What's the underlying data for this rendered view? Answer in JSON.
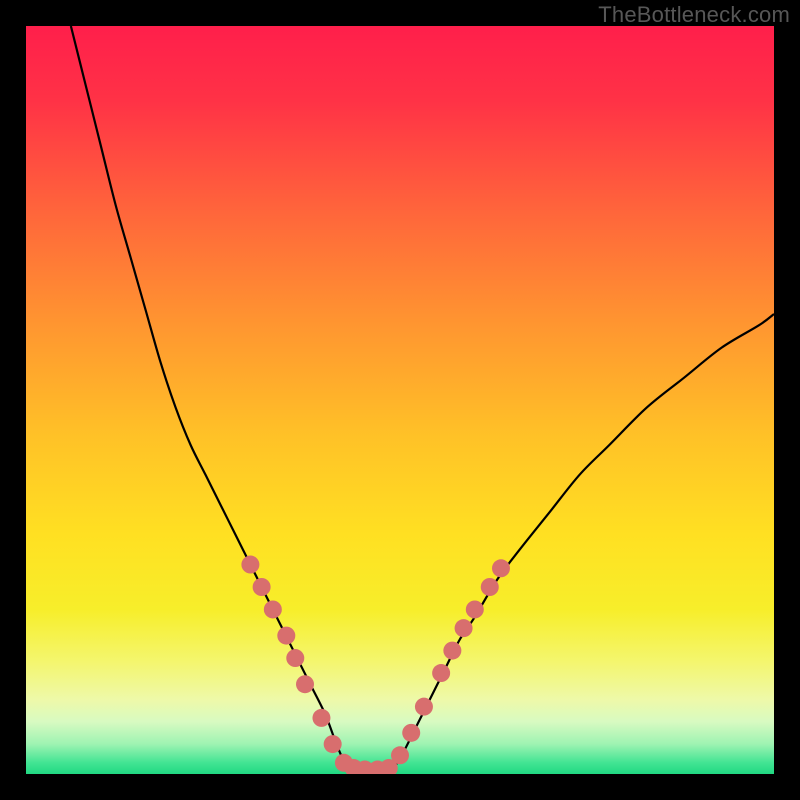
{
  "watermark": "TheBottleneck.com",
  "chart_data": {
    "type": "line",
    "title": "",
    "xlabel": "",
    "ylabel": "",
    "xlim": [
      0,
      100
    ],
    "ylim": [
      0,
      100
    ],
    "grid": false,
    "legend": false,
    "gradient_stops": [
      {
        "offset": 0.0,
        "color": "#ff1f4b"
      },
      {
        "offset": 0.1,
        "color": "#ff3246"
      },
      {
        "offset": 0.25,
        "color": "#ff663b"
      },
      {
        "offset": 0.4,
        "color": "#ff9630"
      },
      {
        "offset": 0.55,
        "color": "#ffc227"
      },
      {
        "offset": 0.68,
        "color": "#ffe022"
      },
      {
        "offset": 0.78,
        "color": "#f7ee2a"
      },
      {
        "offset": 0.85,
        "color": "#f4f66e"
      },
      {
        "offset": 0.9,
        "color": "#eef9a8"
      },
      {
        "offset": 0.93,
        "color": "#d8fac1"
      },
      {
        "offset": 0.96,
        "color": "#9ef3b2"
      },
      {
        "offset": 0.985,
        "color": "#42e493"
      },
      {
        "offset": 1.0,
        "color": "#20d882"
      }
    ],
    "series": [
      {
        "name": "left-curve",
        "color": "#000000",
        "x": [
          6,
          8,
          10,
          12,
          14,
          16,
          18,
          20,
          22,
          24,
          26,
          28,
          30,
          32,
          34,
          36,
          38,
          40,
          41.5,
          43
        ],
        "y": [
          100,
          92,
          84,
          76,
          69,
          62,
          55,
          49,
          44,
          40,
          36,
          32,
          28,
          24,
          20,
          16,
          12,
          8,
          4,
          0.5
        ]
      },
      {
        "name": "right-curve",
        "color": "#000000",
        "x": [
          49,
          50.5,
          52,
          54,
          56,
          58,
          60,
          63,
          66,
          70,
          74,
          78,
          83,
          88,
          93,
          98,
          100
        ],
        "y": [
          0.5,
          3,
          6,
          10,
          14,
          18,
          21,
          26,
          30,
          35,
          40,
          44,
          49,
          53,
          57,
          60,
          61.5
        ]
      },
      {
        "name": "valley-floor",
        "color": "#000000",
        "x": [
          43,
          45,
          47,
          49
        ],
        "y": [
          0.5,
          0.2,
          0.2,
          0.5
        ]
      }
    ],
    "markers": [
      {
        "name": "left-cluster",
        "color": "#d86e6e",
        "r": 9,
        "points": [
          {
            "x": 30.0,
            "y": 28.0
          },
          {
            "x": 31.5,
            "y": 25.0
          },
          {
            "x": 33.0,
            "y": 22.0
          },
          {
            "x": 34.8,
            "y": 18.5
          },
          {
            "x": 36.0,
            "y": 15.5
          },
          {
            "x": 37.3,
            "y": 12.0
          },
          {
            "x": 39.5,
            "y": 7.5
          },
          {
            "x": 41.0,
            "y": 4.0
          },
          {
            "x": 42.5,
            "y": 1.5
          }
        ]
      },
      {
        "name": "floor-cluster",
        "color": "#d86e6e",
        "r": 9,
        "points": [
          {
            "x": 43.8,
            "y": 0.8
          },
          {
            "x": 45.3,
            "y": 0.6
          },
          {
            "x": 47.0,
            "y": 0.6
          },
          {
            "x": 48.5,
            "y": 0.8
          }
        ]
      },
      {
        "name": "right-cluster",
        "color": "#d86e6e",
        "r": 9,
        "points": [
          {
            "x": 50.0,
            "y": 2.5
          },
          {
            "x": 51.5,
            "y": 5.5
          },
          {
            "x": 53.2,
            "y": 9.0
          },
          {
            "x": 55.5,
            "y": 13.5
          },
          {
            "x": 57.0,
            "y": 16.5
          },
          {
            "x": 58.5,
            "y": 19.5
          },
          {
            "x": 60.0,
            "y": 22.0
          },
          {
            "x": 62.0,
            "y": 25.0
          },
          {
            "x": 63.5,
            "y": 27.5
          }
        ]
      }
    ]
  }
}
